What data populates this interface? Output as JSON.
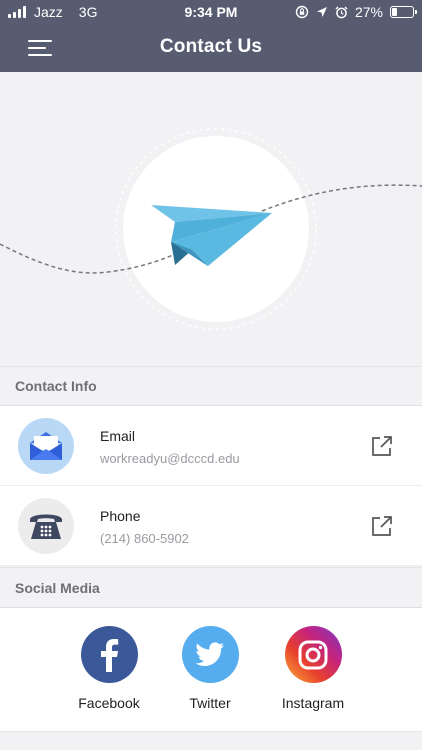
{
  "status_bar": {
    "carrier": "Jazz",
    "network": "3G",
    "time": "9:34 PM",
    "battery_text": "27%",
    "battery_level": 0.27,
    "icons": [
      "signal-icon",
      "orientation-lock-icon",
      "location-arrow-icon",
      "alarm-icon",
      "battery-icon"
    ]
  },
  "nav": {
    "title": "Contact Us",
    "menu_icon": "hamburger-menu-icon"
  },
  "hero": {
    "icon": "paper-plane-icon"
  },
  "contact_info": {
    "header": "Contact Info",
    "items": [
      {
        "label": "Email",
        "value": "workreadyu@dcccd.edu",
        "icon": "envelope-icon",
        "action_icon": "external-link-icon"
      },
      {
        "label": "Phone",
        "value": "(214) 860-5902",
        "icon": "telephone-icon",
        "action_icon": "external-link-icon"
      }
    ]
  },
  "social_media": {
    "header": "Social Media",
    "items": [
      {
        "label": "Facebook",
        "icon": "facebook-icon",
        "color": "#3b5998"
      },
      {
        "label": "Twitter",
        "icon": "twitter-icon",
        "color": "#55acee"
      },
      {
        "label": "Instagram",
        "icon": "instagram-icon",
        "color": "#c13584"
      }
    ]
  },
  "colors": {
    "header_bg": "#575c71",
    "page_bg": "#f2f2f4",
    "plane_blue": "#4fb0d9",
    "email_avatar_bg": "#b9d8f6",
    "phone_avatar_bg": "#ececec"
  }
}
